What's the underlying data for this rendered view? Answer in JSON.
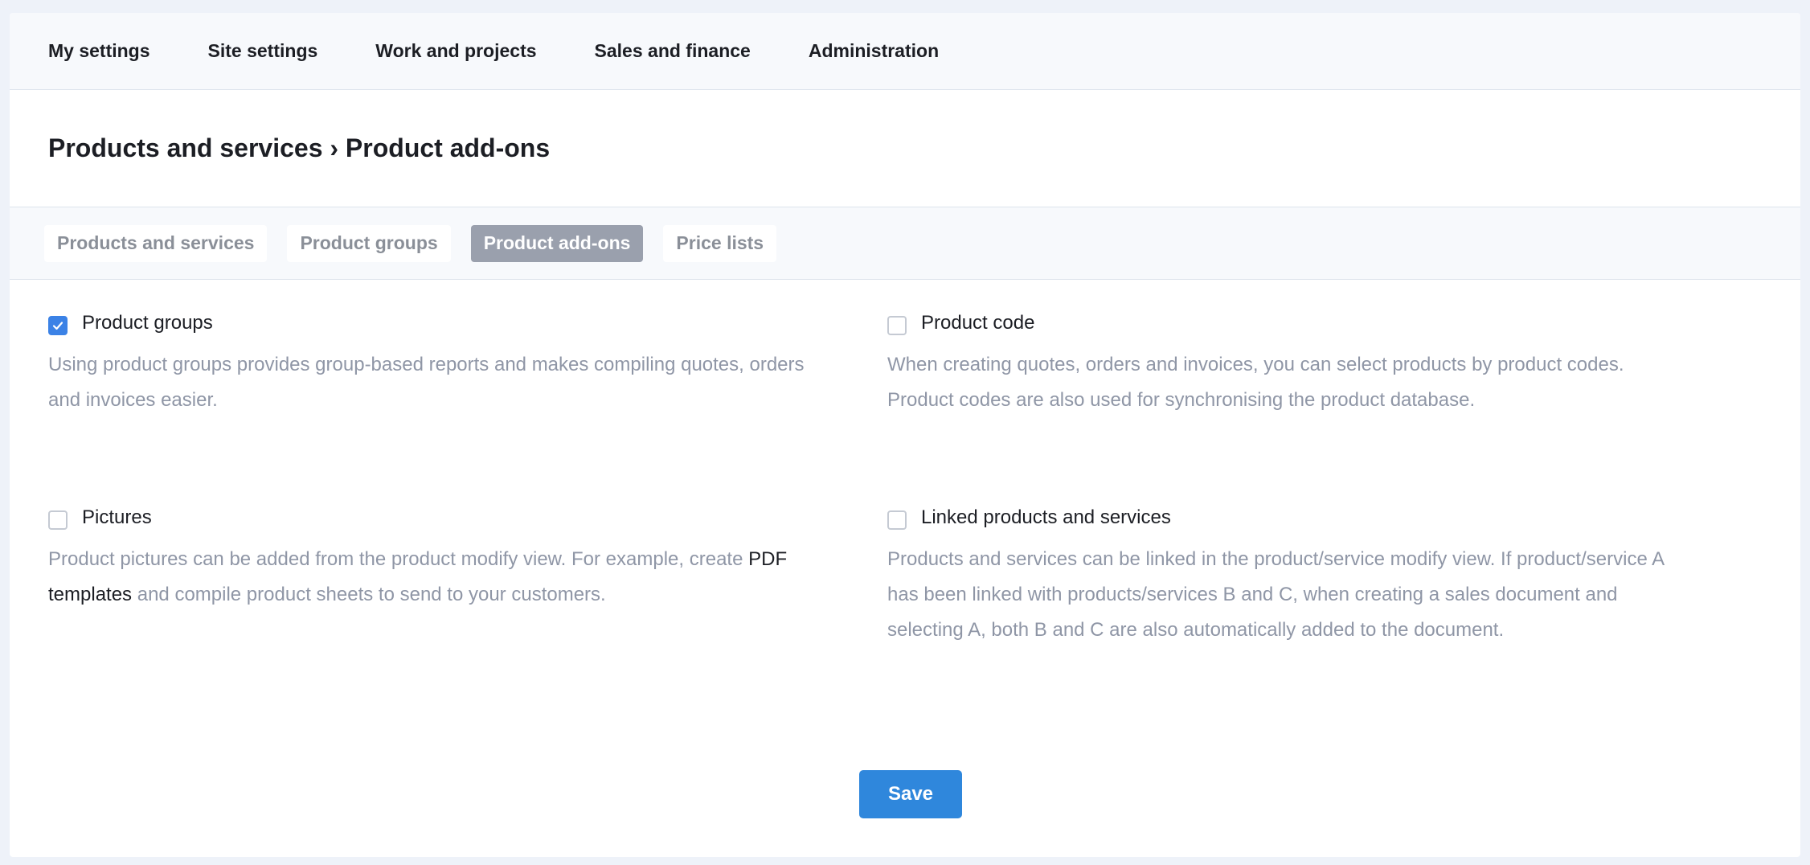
{
  "topnav": {
    "items": [
      "My settings",
      "Site settings",
      "Work and projects",
      "Sales and finance",
      "Administration"
    ]
  },
  "header": {
    "title": "Products and services › Product add-ons"
  },
  "tabs": [
    {
      "label": "Products and services",
      "active": false
    },
    {
      "label": "Product groups",
      "active": false
    },
    {
      "label": "Product add-ons",
      "active": true
    },
    {
      "label": "Price lists",
      "active": false
    }
  ],
  "options": {
    "product_groups": {
      "label": "Product groups",
      "checked": true,
      "description": "Using product groups provides group-based reports and makes compiling quotes, orders and invoices easier."
    },
    "product_code": {
      "label": "Product code",
      "checked": false,
      "description": "When creating quotes, orders and invoices, you can select products by product codes. Product codes are also used for synchronising the product database."
    },
    "pictures": {
      "label": "Pictures",
      "checked": false,
      "description_before": "Product pictures can be added from the product modify view. For example, create ",
      "link": "PDF templates",
      "description_after": " and compile product sheets to send to your customers."
    },
    "linked_products": {
      "label": "Linked products and services",
      "checked": false,
      "description": "Products and services can be linked in the product/service modify view. If product/service A has been linked with products/services B and C, when creating a sales document and selecting A, both B and C are also automatically added to the document."
    }
  },
  "actions": {
    "save_label": "Save"
  },
  "colors": {
    "accent": "#2f87dc",
    "checkbox_checked": "#3b82e6",
    "active_tab": "#9aa0ad",
    "muted_text": "#8f96a6"
  }
}
